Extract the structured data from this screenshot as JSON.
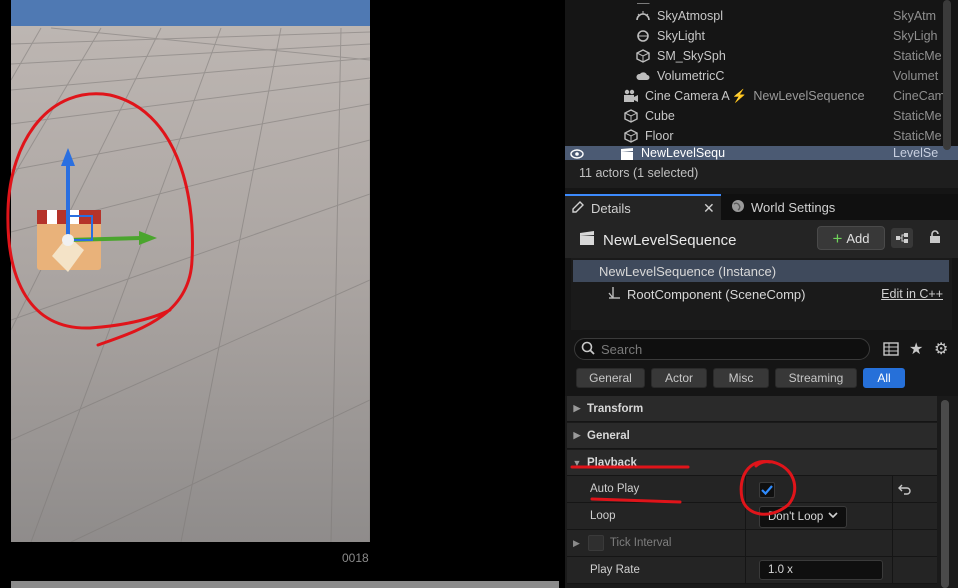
{
  "viewport": {
    "frame_counter": "0018"
  },
  "outliner": {
    "rows": [
      {
        "name": "SkyAtmospl",
        "type": "SkyAtm",
        "icon": "sky-atmosphere-icon"
      },
      {
        "name": "SkyLight",
        "type": "SkyLigh",
        "icon": "skylight-icon"
      },
      {
        "name": "SM_SkySph",
        "type": "StaticMe",
        "icon": "static-mesh-icon"
      },
      {
        "name": "VolumetricC",
        "type": "Volumet",
        "icon": "volumetric-cloud-icon"
      },
      {
        "name": "Cine Camera A",
        "extra": "NewLevelSequence",
        "type": "CineCam",
        "icon": "camera-icon"
      },
      {
        "name": "Cube",
        "type": "StaticMe",
        "icon": "static-mesh-icon"
      },
      {
        "name": "Floor",
        "type": "StaticMe",
        "icon": "static-mesh-icon"
      },
      {
        "name": "NewLevelSequ",
        "type": "LevelSe",
        "icon": "level-sequence-icon"
      }
    ],
    "footer": "11 actors (1 selected)"
  },
  "tabs": {
    "details": "Details",
    "world_settings": "World Settings"
  },
  "details": {
    "actor_name": "NewLevelSequence",
    "add_label": "Add",
    "components": {
      "instance": "NewLevelSequence (Instance)",
      "root": "RootComponent (SceneComp)",
      "edit_link": "Edit in C++"
    },
    "search": {
      "placeholder": "Search"
    },
    "filters": [
      "General",
      "Actor",
      "Misc",
      "Streaming",
      "All"
    ],
    "categories": {
      "transform": "Transform",
      "general": "General",
      "playback": "Playback"
    },
    "properties": {
      "auto_play": {
        "label": "Auto Play",
        "checked": true
      },
      "loop": {
        "label": "Loop",
        "value": "Don't Loop"
      },
      "tick_interval": {
        "label": "Tick Interval"
      },
      "play_rate": {
        "label": "Play Rate",
        "value": "1.0 x"
      }
    }
  },
  "colors": {
    "accent": "#2670d9",
    "selection": "#4b5a73",
    "annotation": "#e0141a"
  }
}
